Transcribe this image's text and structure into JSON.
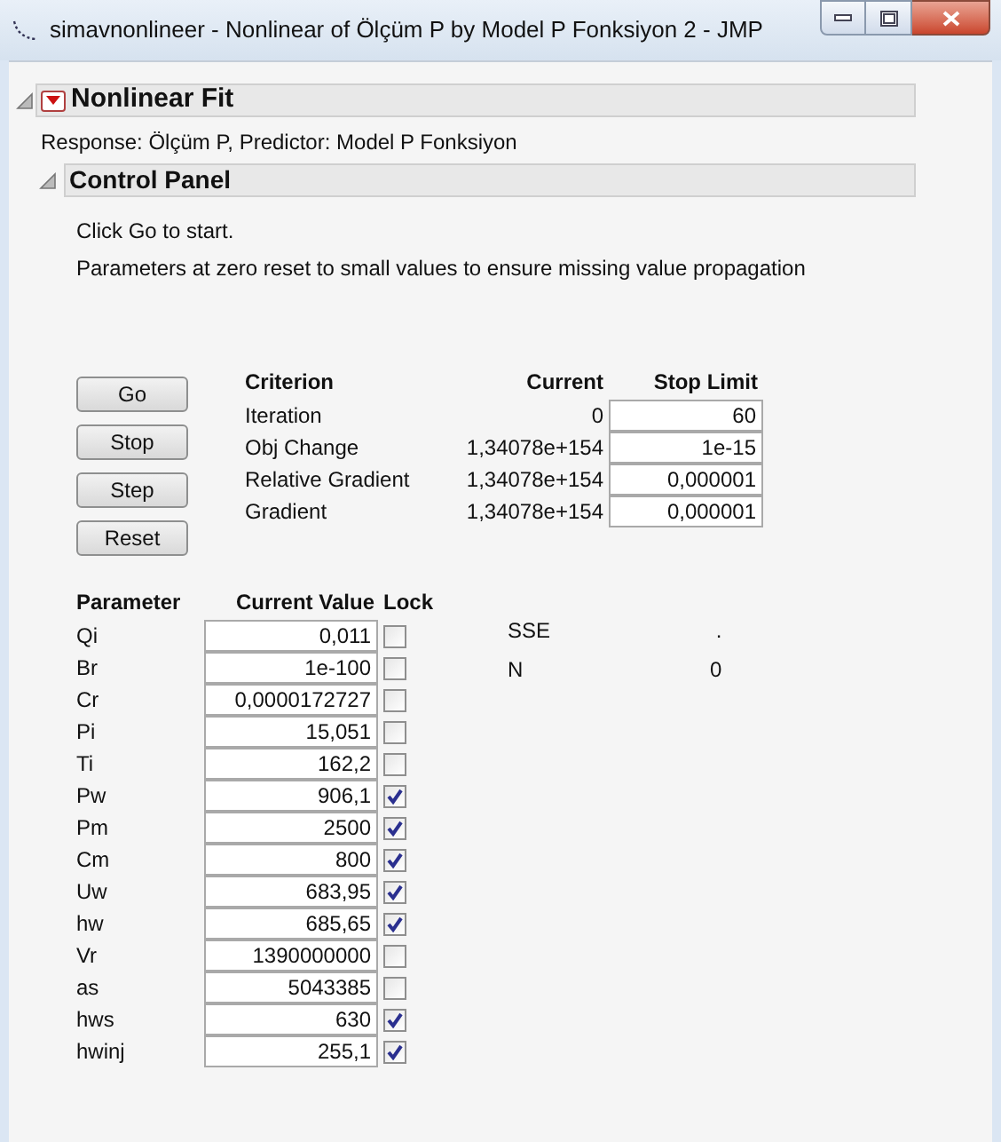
{
  "window": {
    "title": "simavnonlineer - Nonlinear of Ölçüm P by Model P Fonksiyon 2 - JMP"
  },
  "report": {
    "title": "Nonlinear Fit",
    "expanded": true,
    "subtitle": "Response: Ölçüm P, Predictor: Model P Fonksiyon"
  },
  "control_panel": {
    "title": "Control Panel",
    "expanded": true,
    "messages": [
      "Click Go to start.",
      "Parameters at zero reset to small values to ensure missing value propagation"
    ],
    "buttons": [
      "Go",
      "Stop",
      "Step",
      "Reset"
    ],
    "criteria": {
      "columns": [
        "Criterion",
        "Current",
        "Stop Limit"
      ],
      "rows": [
        {
          "criterion": "Iteration",
          "current": "0",
          "stop_limit": "60"
        },
        {
          "criterion": "Obj Change",
          "current": "1,34078e+154",
          "stop_limit": "1e-15"
        },
        {
          "criterion": "Relative Gradient",
          "current": "1,34078e+154",
          "stop_limit": "0,000001"
        },
        {
          "criterion": "Gradient",
          "current": "1,34078e+154",
          "stop_limit": "0,000001"
        }
      ]
    },
    "parameters": {
      "columns": [
        "Parameter",
        "Current Value",
        "Lock"
      ],
      "rows": [
        {
          "name": "Qi",
          "value": "0,011",
          "checked": false
        },
        {
          "name": "Br",
          "value": "1e-100",
          "checked": false
        },
        {
          "name": "Cr",
          "value": "0,0000172727",
          "checked": false
        },
        {
          "name": "Pi",
          "value": "15,051",
          "checked": false
        },
        {
          "name": "Ti",
          "value": "162,2",
          "checked": false
        },
        {
          "name": "Pw",
          "value": "906,1",
          "checked": true
        },
        {
          "name": "Pm",
          "value": "2500",
          "checked": true
        },
        {
          "name": "Cm",
          "value": "800",
          "checked": true
        },
        {
          "name": "Uw",
          "value": "683,95",
          "checked": true
        },
        {
          "name": "hw",
          "value": "685,65",
          "checked": true
        },
        {
          "name": "Vr",
          "value": "1390000000",
          "checked": false
        },
        {
          "name": "as",
          "value": "5043385",
          "checked": false
        },
        {
          "name": "hws",
          "value": "630",
          "checked": true
        },
        {
          "name": "hwinj",
          "value": "255,1",
          "checked": true
        }
      ]
    },
    "stats": [
      {
        "label": "SSE",
        "value": "."
      },
      {
        "label": "N",
        "value": "0"
      }
    ]
  }
}
